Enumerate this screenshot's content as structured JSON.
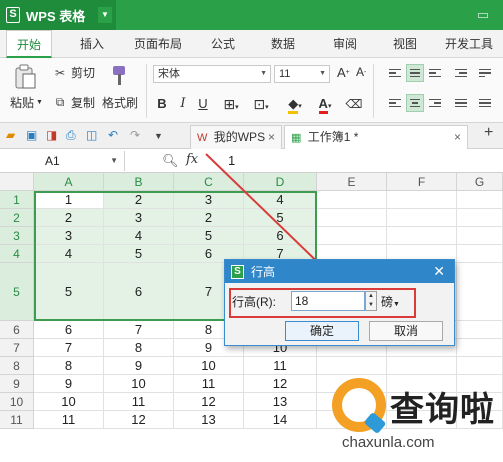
{
  "app": {
    "title": "WPS 表格",
    "logo_glyph": "S"
  },
  "tabs": [
    "开始",
    "插入",
    "页面布局",
    "公式",
    "数据",
    "审阅",
    "视图",
    "开发工具"
  ],
  "ribbon": {
    "paste": "粘贴",
    "cut": "剪切",
    "copy": "复制",
    "format_painter": "格式刷",
    "font_name": "宋体",
    "font_size": "11",
    "bold": "B",
    "italic": "I",
    "underline": "U"
  },
  "doc_tabs": {
    "home": "我的WPS",
    "workbook": "工作簿1 *"
  },
  "formula_bar": {
    "name_box": "A1",
    "fx": "fx",
    "value": "1"
  },
  "grid": {
    "columns": [
      "A",
      "B",
      "C",
      "D",
      "E",
      "F",
      "G"
    ],
    "rows": [
      "1",
      "2",
      "3",
      "4",
      "5",
      "6",
      "7",
      "8",
      "9",
      "10",
      "11"
    ],
    "cells": [
      [
        "1",
        "2",
        "3",
        "4"
      ],
      [
        "2",
        "3",
        "2",
        "5"
      ],
      [
        "3",
        "4",
        "5",
        "6"
      ],
      [
        "4",
        "5",
        "6",
        "7"
      ],
      [
        "5",
        "6",
        "7",
        "8"
      ],
      [
        "6",
        "7",
        "8",
        "9"
      ],
      [
        "7",
        "8",
        "9",
        "10"
      ],
      [
        "8",
        "9",
        "10",
        "11"
      ],
      [
        "9",
        "10",
        "11",
        "12"
      ],
      [
        "10",
        "11",
        "12",
        "13"
      ],
      [
        "11",
        "12",
        "13",
        "14"
      ]
    ]
  },
  "dialog": {
    "title": "行高",
    "label": "行高(R):",
    "value": "18",
    "unit": "磅",
    "ok": "确定",
    "cancel": "取消"
  },
  "watermark": {
    "cn": "查询啦",
    "en": "chaxunla.com"
  },
  "colors": {
    "brand_green": "#2aa149",
    "dialog_blue": "#2f86c9",
    "annotation_red": "#d93b3b"
  }
}
